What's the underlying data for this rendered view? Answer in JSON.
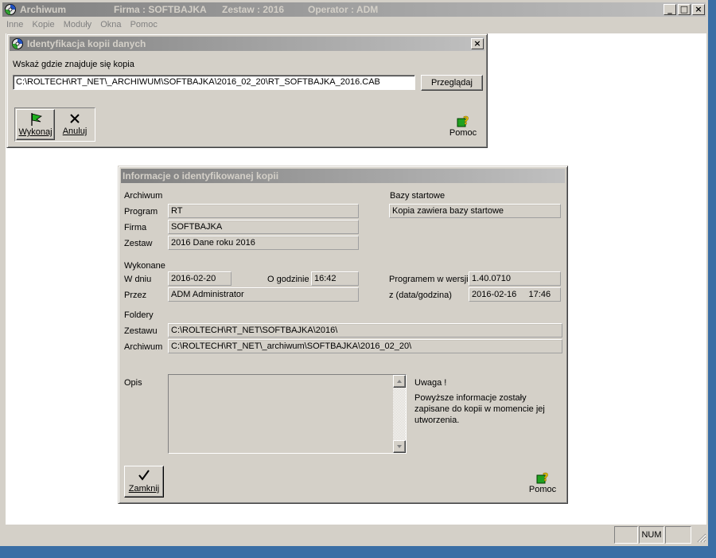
{
  "main_window": {
    "app_title": "Archiwum",
    "firma": "Firma : SOFTBAJKA",
    "zestaw": "Zestaw : 2016",
    "operator": "Operator : ADM",
    "controls": {
      "minimize": "_",
      "maximize": "□",
      "close": "×"
    }
  },
  "menu": [
    "Inne",
    "Kopie",
    "Moduły",
    "Okna",
    "Pomoc"
  ],
  "dialog_ident": {
    "title": "Identyfikacja kopii danych",
    "prompt": "Wskaż gdzie znajduje się kopia",
    "path_value": "C:\\ROLTECH\\RT_NET\\_ARCHIWUM\\SOFTBAJKA\\2016_02_20\\RT_SOFTBAJKA_2016.CAB",
    "browse_label": "Przeglądaj",
    "execute_label": "Wykonaj",
    "cancel_label": "Anuluj",
    "help_label": "Pomoc",
    "close": "×"
  },
  "dialog_info": {
    "title": "Informacje o identyfikowanej kopii",
    "archiwum_heading": "Archiwum",
    "program_label": "Program",
    "program_value": "RT",
    "firma_label": "Firma",
    "firma_value": "SOFTBAJKA",
    "zestaw_label": "Zestaw",
    "zestaw_value": "2016  Dane roku 2016",
    "bazy_heading": "Bazy startowe",
    "bazy_value": "Kopia zawiera bazy startowe",
    "wykonane_heading": "Wykonane",
    "w_dniu_label": "W dniu",
    "w_dniu_value": "2016-02-20",
    "o_godzinie_label": "O godzinie",
    "o_godzinie_value": "16:42",
    "przez_label": "Przez",
    "przez_value": "ADM  Administrator",
    "wersja_label": "Programem w wersji",
    "wersja_value": "1.40.0710",
    "data_godzina_label": "z (data/godzina)",
    "data_godzina_value": "2016-02-16     17:46",
    "foldery_heading": "Foldery",
    "zestawu_label": "Zestawu",
    "zestawu_value": "C:\\ROLTECH\\RT_NET\\SOFTBAJKA\\2016\\",
    "archiwum_label": "Archiwum",
    "archiwum_value": "C:\\ROLTECH\\RT_NET\\_archiwum\\SOFTBAJKA\\2016_02_20\\",
    "opis_label": "Opis",
    "opis_value": "",
    "uwaga_title": "Uwaga !",
    "uwaga_text": "Powyższe informacje zostały zapisane do kopii w momencie jej utworzenia.",
    "close_label": "Zamknij",
    "help_label": "Pomoc"
  },
  "statusbar": {
    "num": "NUM"
  }
}
